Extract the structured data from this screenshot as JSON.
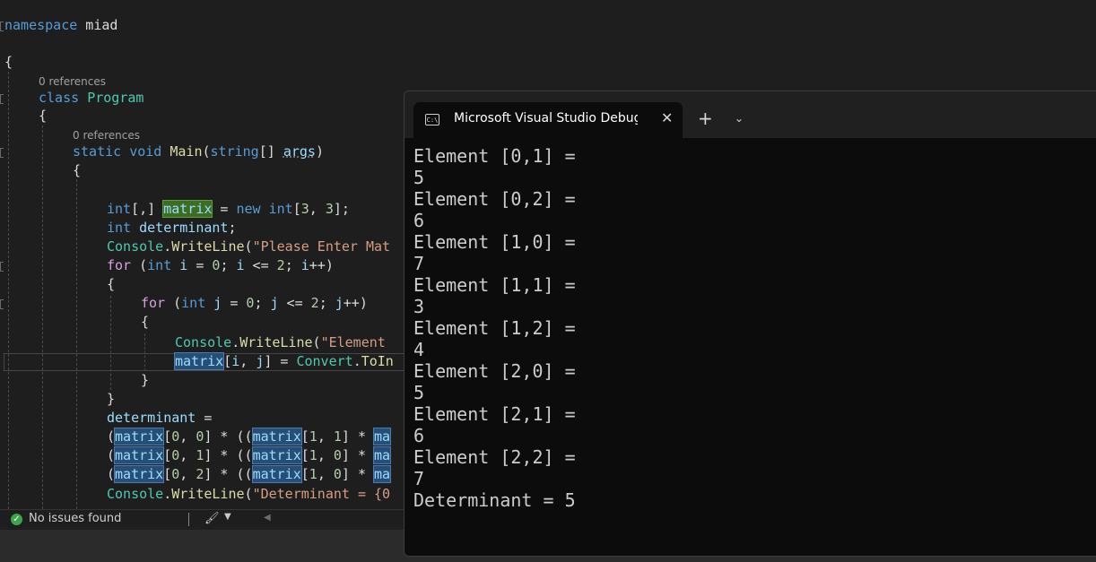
{
  "editor": {
    "lines": [
      {
        "top": 0,
        "spans": [
          {
            "t": "namespace",
            "c": "kw"
          },
          {
            "t": " miad",
            "c": "plain"
          }
        ]
      },
      {
        "top": 0,
        "spans": [
          {
            "t": "{",
            "c": "plain"
          }
        ]
      },
      {
        "top": 0,
        "spans": [
          {
            "t": "class",
            "c": "kw"
          },
          {
            "t": " ",
            "c": "plain"
          },
          {
            "t": "Program",
            "c": "cls"
          }
        ]
      },
      {
        "top": 0,
        "spans": [
          {
            "t": "{",
            "c": "plain"
          }
        ]
      },
      {
        "top": 0,
        "spans": [
          {
            "t": "static",
            "c": "kw"
          },
          {
            "t": " ",
            "c": "plain"
          },
          {
            "t": "void",
            "c": "kw"
          },
          {
            "t": " ",
            "c": "plain"
          },
          {
            "t": "Main",
            "c": "mth"
          },
          {
            "t": "(",
            "c": "plain"
          },
          {
            "t": "string",
            "c": "kw"
          },
          {
            "t": "[] ",
            "c": "plain"
          },
          {
            "t": "args",
            "c": "prm squig"
          },
          {
            "t": ")",
            "c": "plain"
          }
        ]
      },
      {
        "top": 0,
        "spans": [
          {
            "t": "{",
            "c": "plain"
          }
        ]
      },
      {
        "top": 0,
        "spans": [
          {
            "t": "int",
            "c": "kw"
          },
          {
            "t": "[,] ",
            "c": "plain"
          },
          {
            "t": "matrix",
            "c": "var hl-def"
          },
          {
            "t": " = ",
            "c": "plain"
          },
          {
            "t": "new",
            "c": "kw"
          },
          {
            "t": " ",
            "c": "plain"
          },
          {
            "t": "int",
            "c": "kw"
          },
          {
            "t": "[",
            "c": "plain"
          },
          {
            "t": "3",
            "c": "num"
          },
          {
            "t": ", ",
            "c": "plain"
          },
          {
            "t": "3",
            "c": "num"
          },
          {
            "t": "];",
            "c": "plain"
          }
        ]
      },
      {
        "top": 0,
        "spans": [
          {
            "t": "int",
            "c": "kw"
          },
          {
            "t": " ",
            "c": "plain"
          },
          {
            "t": "determinant",
            "c": "var"
          },
          {
            "t": ";",
            "c": "plain"
          }
        ]
      },
      {
        "top": 0,
        "spans": [
          {
            "t": "Console",
            "c": "cls"
          },
          {
            "t": ".",
            "c": "plain"
          },
          {
            "t": "WriteLine",
            "c": "mth"
          },
          {
            "t": "(",
            "c": "plain"
          },
          {
            "t": "\"Please Enter Mat",
            "c": "str"
          }
        ]
      },
      {
        "top": 0,
        "spans": [
          {
            "t": "for",
            "c": "ctl"
          },
          {
            "t": " (",
            "c": "plain"
          },
          {
            "t": "int",
            "c": "kw"
          },
          {
            "t": " ",
            "c": "plain"
          },
          {
            "t": "i",
            "c": "var"
          },
          {
            "t": " = ",
            "c": "plain"
          },
          {
            "t": "0",
            "c": "num"
          },
          {
            "t": "; ",
            "c": "plain"
          },
          {
            "t": "i",
            "c": "var"
          },
          {
            "t": " <= ",
            "c": "plain"
          },
          {
            "t": "2",
            "c": "num"
          },
          {
            "t": "; ",
            "c": "plain"
          },
          {
            "t": "i",
            "c": "var"
          },
          {
            "t": "++)",
            "c": "plain"
          }
        ]
      },
      {
        "top": 0,
        "spans": [
          {
            "t": "{",
            "c": "plain"
          }
        ]
      },
      {
        "top": 0,
        "spans": [
          {
            "t": "for",
            "c": "ctl"
          },
          {
            "t": " (",
            "c": "plain"
          },
          {
            "t": "int",
            "c": "kw"
          },
          {
            "t": " ",
            "c": "plain"
          },
          {
            "t": "j",
            "c": "var"
          },
          {
            "t": " = ",
            "c": "plain"
          },
          {
            "t": "0",
            "c": "num"
          },
          {
            "t": "; ",
            "c": "plain"
          },
          {
            "t": "j",
            "c": "var"
          },
          {
            "t": " <= ",
            "c": "plain"
          },
          {
            "t": "2",
            "c": "num"
          },
          {
            "t": "; ",
            "c": "plain"
          },
          {
            "t": "j",
            "c": "var"
          },
          {
            "t": "++)",
            "c": "plain"
          }
        ]
      },
      {
        "top": 0,
        "spans": [
          {
            "t": "{",
            "c": "plain"
          }
        ]
      },
      {
        "top": 0,
        "spans": [
          {
            "t": "Console",
            "c": "cls"
          },
          {
            "t": ".",
            "c": "plain"
          },
          {
            "t": "WriteLine",
            "c": "mth"
          },
          {
            "t": "(",
            "c": "plain"
          },
          {
            "t": "\"Element ",
            "c": "str"
          }
        ]
      },
      {
        "top": 0,
        "spans": [
          {
            "t": "matrix",
            "c": "var hl"
          },
          {
            "t": "[",
            "c": "plain"
          },
          {
            "t": "i",
            "c": "var"
          },
          {
            "t": ", ",
            "c": "plain"
          },
          {
            "t": "j",
            "c": "var"
          },
          {
            "t": "] = ",
            "c": "plain"
          },
          {
            "t": "Convert",
            "c": "cls"
          },
          {
            "t": ".",
            "c": "plain"
          },
          {
            "t": "ToIn",
            "c": "mth"
          }
        ]
      },
      {
        "top": 0,
        "spans": [
          {
            "t": "}",
            "c": "plain"
          }
        ]
      },
      {
        "top": 0,
        "spans": [
          {
            "t": "}",
            "c": "plain"
          }
        ]
      },
      {
        "top": 0,
        "spans": [
          {
            "t": "determinant",
            "c": "var"
          },
          {
            "t": " =",
            "c": "plain"
          }
        ]
      },
      {
        "top": 0,
        "spans": [
          {
            "t": "(",
            "c": "plain"
          },
          {
            "t": "matrix",
            "c": "var hl"
          },
          {
            "t": "[",
            "c": "plain"
          },
          {
            "t": "0",
            "c": "num"
          },
          {
            "t": ", ",
            "c": "plain"
          },
          {
            "t": "0",
            "c": "num"
          },
          {
            "t": "] * ((",
            "c": "plain"
          },
          {
            "t": "matrix",
            "c": "var hl"
          },
          {
            "t": "[",
            "c": "plain"
          },
          {
            "t": "1",
            "c": "num"
          },
          {
            "t": ", ",
            "c": "plain"
          },
          {
            "t": "1",
            "c": "num"
          },
          {
            "t": "] * ",
            "c": "plain"
          },
          {
            "t": "ma",
            "c": "var hl"
          }
        ]
      },
      {
        "top": 0,
        "spans": [
          {
            "t": "(",
            "c": "plain"
          },
          {
            "t": "matrix",
            "c": "var hl"
          },
          {
            "t": "[",
            "c": "plain"
          },
          {
            "t": "0",
            "c": "num"
          },
          {
            "t": ", ",
            "c": "plain"
          },
          {
            "t": "1",
            "c": "num"
          },
          {
            "t": "] * ((",
            "c": "plain"
          },
          {
            "t": "matrix",
            "c": "var hl"
          },
          {
            "t": "[",
            "c": "plain"
          },
          {
            "t": "1",
            "c": "num"
          },
          {
            "t": ", ",
            "c": "plain"
          },
          {
            "t": "0",
            "c": "num"
          },
          {
            "t": "] * ",
            "c": "plain"
          },
          {
            "t": "ma",
            "c": "var hl"
          }
        ]
      },
      {
        "top": 0,
        "spans": [
          {
            "t": "(",
            "c": "plain"
          },
          {
            "t": "matrix",
            "c": "var hl"
          },
          {
            "t": "[",
            "c": "plain"
          },
          {
            "t": "0",
            "c": "num"
          },
          {
            "t": ", ",
            "c": "plain"
          },
          {
            "t": "2",
            "c": "num"
          },
          {
            "t": "] * ((",
            "c": "plain"
          },
          {
            "t": "matrix",
            "c": "var hl"
          },
          {
            "t": "[",
            "c": "plain"
          },
          {
            "t": "1",
            "c": "num"
          },
          {
            "t": ", ",
            "c": "plain"
          },
          {
            "t": "0",
            "c": "num"
          },
          {
            "t": "] * ",
            "c": "plain"
          },
          {
            "t": "ma",
            "c": "var hl"
          }
        ]
      },
      {
        "top": 0,
        "spans": [
          {
            "t": "Console",
            "c": "cls"
          },
          {
            "t": ".",
            "c": "plain"
          },
          {
            "t": "WriteLine",
            "c": "mth"
          },
          {
            "t": "(",
            "c": "plain"
          },
          {
            "t": "\"Determinant = {0",
            "c": "str"
          }
        ]
      }
    ],
    "codelens": [
      "0 references",
      "0 references"
    ]
  },
  "statusbar": {
    "issues_text": "No issues found",
    "issues_icon": "check-circle-icon",
    "brush_icon": "code-cleanup-brush-icon"
  },
  "terminal": {
    "tab_title": "Microsoft Visual Studio Debug Console",
    "tab_icon_text": "C:\\",
    "close_glyph": "✕",
    "new_tab_glyph": "+",
    "dropdown_glyph": "⌄",
    "output": [
      "Element [0,1] =",
      "5",
      "Element [0,2] =",
      "6",
      "Element [1,0] =",
      "7",
      "Element [1,1] =",
      "3",
      "Element [1,2] =",
      "4",
      "Element [2,0] =",
      "5",
      "Element [2,1] =",
      "6",
      "Element [2,2] =",
      "7",
      "Determinant = 5"
    ]
  }
}
